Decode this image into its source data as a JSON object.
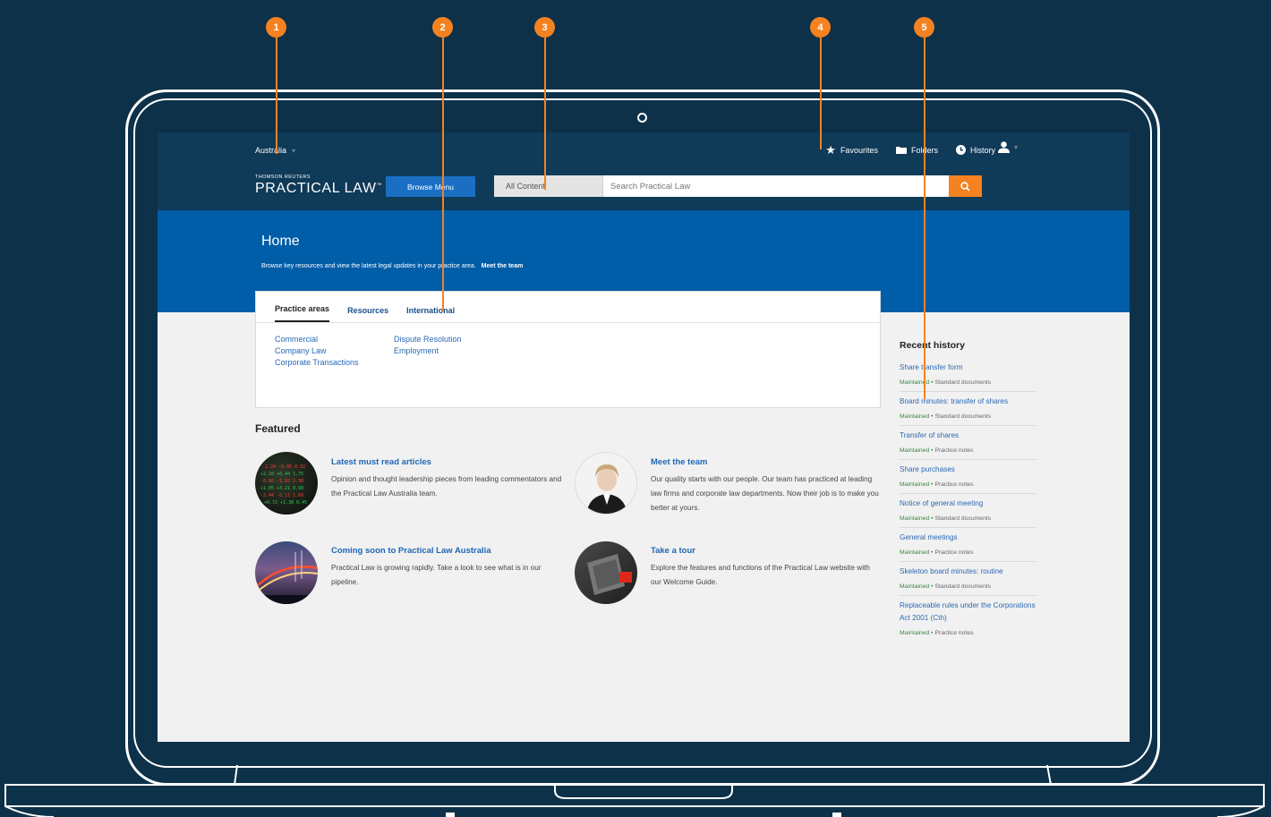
{
  "header": {
    "region": "Australia",
    "links": [
      {
        "label": "Favourites",
        "icon": "star-icon"
      },
      {
        "label": "Folders",
        "icon": "folder-icon"
      },
      {
        "label": "History",
        "icon": "history-icon"
      }
    ],
    "user_icon": "user-icon",
    "logo_small": "THOMSON REUTERS",
    "logo_big": "PRACTICAL LAW",
    "logo_tm": "™",
    "browse_label": "Browse Menu",
    "search": {
      "scope": "All Content",
      "placeholder": "Search Practical Law"
    }
  },
  "hero": {
    "title": "Home",
    "subtitle": "Browse key resources and view the latest legal updates in your practice area.",
    "meet_link": "Meet the team"
  },
  "tabs": {
    "items": [
      "Practice areas",
      "Resources",
      "International"
    ],
    "active": "Practice areas",
    "col1": [
      "Commercial",
      "Company Law",
      "Corporate Transactions"
    ],
    "col2": [
      "Dispute Resolution",
      "Employment"
    ]
  },
  "featured": {
    "heading": "Featured",
    "items": [
      {
        "title": "Latest must read articles",
        "desc": "Opinion and thought leadership pieces from leading commentators and the Practical Law Australia team."
      },
      {
        "title": "Meet the team",
        "desc": "Our quality starts with our people. Our team has practiced at leading law firms and corporate law departments. Now their job is to make you better at yours."
      },
      {
        "title": "Coming soon to Practical Law Australia",
        "desc": "Practical Law is growing rapidly. Take a look to see what is in our pipeline."
      },
      {
        "title": "Take a tour",
        "desc": "Explore the features and functions of the Practical Law website with our Welcome Guide."
      }
    ]
  },
  "recent_history": {
    "title": "Recent history",
    "items": [
      {
        "title": "Share transfer form",
        "status": "Maintained",
        "type": "Standard documents"
      },
      {
        "title": "Board minutes: transfer of shares",
        "status": "Maintained",
        "type": "Standard documents"
      },
      {
        "title": "Transfer of shares",
        "status": "Maintained",
        "type": "Practice notes"
      },
      {
        "title": "Share purchases",
        "status": "Maintained",
        "type": "Practice notes"
      },
      {
        "title": "Notice of general meeting",
        "status": "Maintained",
        "type": "Standard documents"
      },
      {
        "title": "General meetings",
        "status": "Maintained",
        "type": "Practice notes"
      },
      {
        "title": "Skeleton board minutes: routine",
        "status": "Maintained",
        "type": "Standard documents"
      },
      {
        "title": "Replaceable rules under the Corporations Act 2001 (Cth)",
        "status": "Maintained",
        "type": "Practice notes"
      }
    ]
  },
  "callouts": [
    "1",
    "2",
    "3",
    "4",
    "5"
  ],
  "colors": {
    "background": "#0d3149",
    "topbar": "#0f3a58",
    "hero": "#005da7",
    "accent_orange": "#f58220",
    "link_blue": "#2a69b5"
  }
}
